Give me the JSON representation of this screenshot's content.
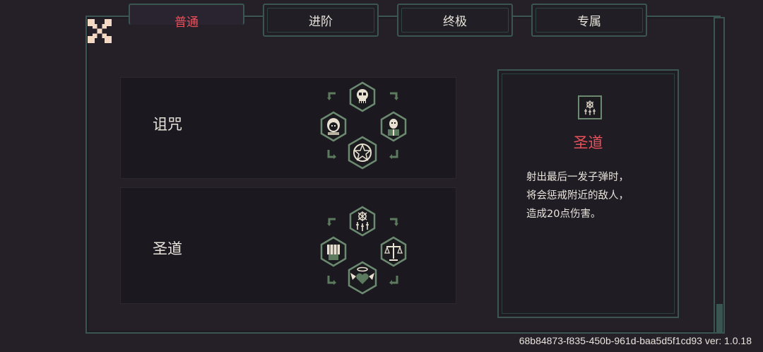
{
  "tabs": [
    {
      "label": "普通",
      "active": true
    },
    {
      "label": "进阶",
      "active": false
    },
    {
      "label": "终极",
      "active": false
    },
    {
      "label": "专属",
      "active": false
    }
  ],
  "rows": [
    {
      "label": "诅咒",
      "icons": [
        "skull-icon",
        "hooded-figure-icon",
        "cultist-icon",
        "pentagram-icon"
      ]
    },
    {
      "label": "圣道",
      "icons": [
        "holy-sigil-icon",
        "fist-icon",
        "scales-icon",
        "winged-heart-icon"
      ]
    }
  ],
  "detail": {
    "icon": "holy-sigil-icon",
    "title": "圣道",
    "lines": [
      "射出最后一发子弹时，",
      "将会惩戒附近的敌人，",
      "造成20点伤害。"
    ]
  },
  "footer": {
    "version_text": "68b84873-f835-450b-961d-baa5d5f1cd93 ver: 1.0.18"
  },
  "colors": {
    "accent": "#e8505a",
    "frame": "#3a5552",
    "arrow": "#5c7a5e",
    "background": "#252028"
  }
}
